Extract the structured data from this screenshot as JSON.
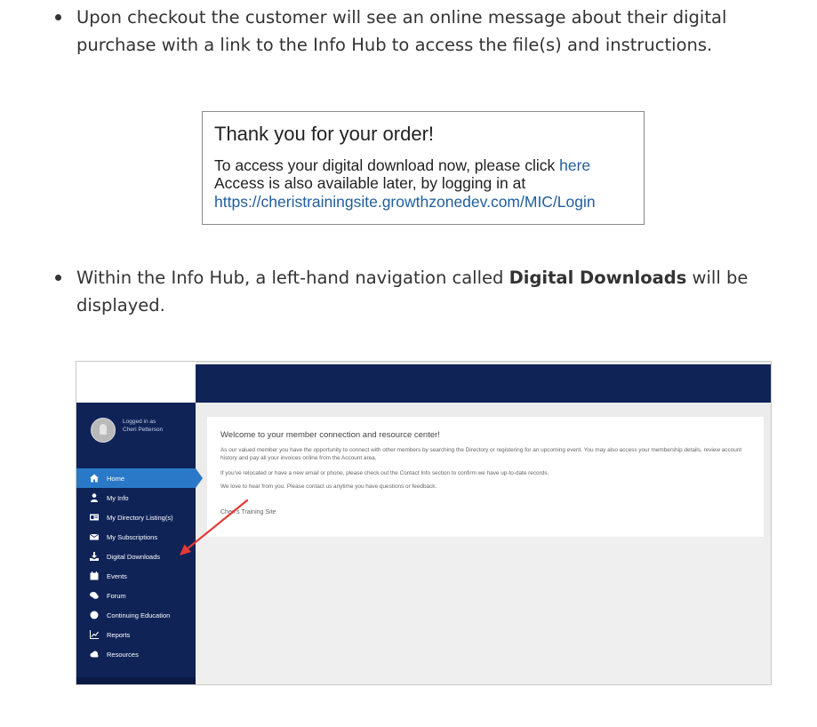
{
  "bullets": {
    "first": "Upon checkout the customer will see an online message about their digital purchase with a link to the Info Hub to access the file(s) and instructions.",
    "second_before": "Within the Info Hub, a left-hand navigation called ",
    "second_bold": "Digital Downloads",
    "second_after": " will be displayed."
  },
  "thanks": {
    "title": "Thank you for your order!",
    "line1_text": "To access your digital download now, please click ",
    "line1_link": "here",
    "line2": "Access is also available later, by logging in at",
    "line3_link": "https://cheristrainingsite.growthzonedev.com/MIC/Login"
  },
  "app": {
    "login": {
      "line1": "Logged in as",
      "line2": "Cheri Petterson"
    },
    "nav": [
      {
        "label": "Home",
        "icon": "home-icon"
      },
      {
        "label": "My Info",
        "icon": "person-icon"
      },
      {
        "label": "My Directory Listing(s)",
        "icon": "id-card-icon"
      },
      {
        "label": "My Subscriptions",
        "icon": "envelope-icon"
      },
      {
        "label": "Digital Downloads",
        "icon": "download-icon"
      },
      {
        "label": "Events",
        "icon": "calendar-icon"
      },
      {
        "label": "Forum",
        "icon": "chat-icon"
      },
      {
        "label": "Continuing Education",
        "icon": "circle-icon"
      },
      {
        "label": "Reports",
        "icon": "chart-icon"
      },
      {
        "label": "Resources",
        "icon": "cloud-icon"
      }
    ],
    "active_nav": "Home",
    "content": {
      "welcome": "Welcome to your member connection and resource center!",
      "p1": "As our valued member you have the opportunity to connect with other members by searching the Directory or registering for an upcoming event. You may also access your membership details, review account history and pay all your invoices online from the Account area.",
      "p2": "If you've relocated or have a new email or phone, please check out the Contact Info section to confirm we have up-to-date records.",
      "p3": "We love to hear from you. Please contact us anytime you have questions or feedback.",
      "site": "Cheri's Training Site"
    },
    "colors": {
      "nav_bg": "#0f2357",
      "active": "#2a79c9",
      "arrow": "#e53935"
    }
  }
}
